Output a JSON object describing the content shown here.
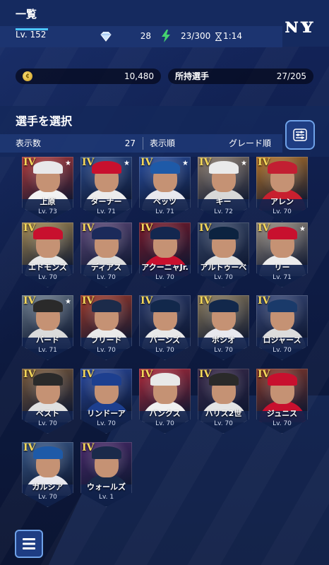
{
  "header": {
    "title": "一覧",
    "team_logo": "ny-logo"
  },
  "status": {
    "level": "Lv. 152",
    "gems": "28",
    "stamina": "23/300",
    "timer": "1:14"
  },
  "resources": {
    "coins": "10,480",
    "players_label": "所持選手",
    "players_count": "27/205"
  },
  "section": {
    "title": "選手を選択",
    "count_label": "表示数",
    "count_value": "27",
    "order_label": "表示順",
    "order_value": "グレード順"
  },
  "colors": {
    "accent": "#4cc6ff",
    "grade": "#f3d65a",
    "panel": "#152a5f"
  },
  "cards": [
    {
      "name": "上原",
      "lv": "Lv. 73",
      "grade": "IV",
      "cap": "#e8e8ea",
      "jersey": "#f2f2f2",
      "bg": "#b13a3a",
      "star": "★"
    },
    {
      "name": "ターナー",
      "lv": "Lv. 71",
      "grade": "IV",
      "cap": "#c8102e",
      "jersey": "#ececec",
      "bg": "#2c4b8a",
      "star": "★"
    },
    {
      "name": "ベッツ",
      "lv": "Lv. 71",
      "grade": "IV",
      "cap": "#1e5aa8",
      "jersey": "#e8e8ee",
      "bg": "#2a4fa0",
      "star": "★"
    },
    {
      "name": "キー",
      "lv": "Lv. 72",
      "grade": "IV",
      "cap": "#eaeaea",
      "jersey": "#d8d8d8",
      "bg": "#8a7a6a",
      "star": "★"
    },
    {
      "name": "アレン",
      "lv": "Lv. 70",
      "grade": "IV",
      "cap": "#c21f32",
      "jersey": "#c8202f",
      "bg": "#b6752a",
      "star": ""
    },
    {
      "name": "エドモンズ",
      "lv": "Lv. 70",
      "grade": "IV",
      "cap": "#c8102e",
      "jersey": "#e6e6e6",
      "bg": "#a68b52",
      "star": ""
    },
    {
      "name": "ディアス",
      "lv": "Lv. 70",
      "grade": "IV",
      "cap": "#1b2a5a",
      "jersey": "#dcdcdc",
      "bg": "#5e4a7a",
      "star": ""
    },
    {
      "name": "アクーニャJr.",
      "lv": "Lv. 70",
      "grade": "IV",
      "cap": "#13274f",
      "jersey": "#c8102e",
      "bg": "#7a1a2a",
      "star": ""
    },
    {
      "name": "アルトゥーベ",
      "lv": "Lv. 70",
      "grade": "IV",
      "cap": "#0c2340",
      "jersey": "#e0e0e0",
      "bg": "#3a4a6a",
      "star": ""
    },
    {
      "name": "リー",
      "lv": "Lv. 71",
      "grade": "IV",
      "cap": "#c8102e",
      "jersey": "#ececec",
      "bg": "#9a8f80",
      "star": "★"
    },
    {
      "name": "バード",
      "lv": "Lv. 71",
      "grade": "IV",
      "cap": "#2a2a2a",
      "jersey": "#dadada",
      "bg": "#6a7a8a",
      "star": "★"
    },
    {
      "name": "フリード",
      "lv": "Lv. 70",
      "grade": "IV",
      "cap": "#1c2b4a",
      "jersey": "#eaeaea",
      "bg": "#a03a2a",
      "star": ""
    },
    {
      "name": "バーンズ",
      "lv": "Lv. 70",
      "grade": "IV",
      "cap": "#12284b",
      "jersey": "#e8e8e8",
      "bg": "#2a3a6a",
      "star": ""
    },
    {
      "name": "ボシオ",
      "lv": "Lv. 70",
      "grade": "IV",
      "cap": "#12284b",
      "jersey": "#e8e8ee",
      "bg": "#8a7a5a",
      "star": ""
    },
    {
      "name": "ロジャース",
      "lv": "Lv. 70",
      "grade": "IV",
      "cap": "#1a3a6a",
      "jersey": "#dcdcdc",
      "bg": "#3a4a7a",
      "star": ""
    },
    {
      "name": "ベスト",
      "lv": "Lv. 70",
      "grade": "IV",
      "cap": "#2a2a2a",
      "jersey": "#e0e0e0",
      "bg": "#7a5a3a",
      "star": ""
    },
    {
      "name": "リンドーア",
      "lv": "Lv. 70",
      "grade": "IV",
      "cap": "#1d3f8f",
      "jersey": "#1d3f8f",
      "bg": "#2a4aa0",
      "star": ""
    },
    {
      "name": "バンクス",
      "lv": "Lv. 70",
      "grade": "IV",
      "cap": "#e8e8e8",
      "jersey": "#f0f0f0",
      "bg": "#b02a3a",
      "star": ""
    },
    {
      "name": "ハリス2世",
      "lv": "Lv. 70",
      "grade": "IV",
      "cap": "#2a2a2a",
      "jersey": "#e4e4e4",
      "bg": "#3a2a4a",
      "star": ""
    },
    {
      "name": "ジュニス",
      "lv": "Lv. 70",
      "grade": "IV",
      "cap": "#c8102e",
      "jersey": "#c8102e",
      "bg": "#8a3a2a",
      "star": ""
    },
    {
      "name": "ガルシア",
      "lv": "Lv. 70",
      "grade": "IV",
      "cap": "#1e5aa8",
      "jersey": "#e8e8ee",
      "bg": "#3a5a8a",
      "star": ""
    },
    {
      "name": "ウォールズ",
      "lv": "Lv. 1",
      "grade": "IV",
      "cap": "#1a2a4a",
      "jersey": "#1a2a4a",
      "bg": "#4a2a6a",
      "star": ""
    }
  ]
}
